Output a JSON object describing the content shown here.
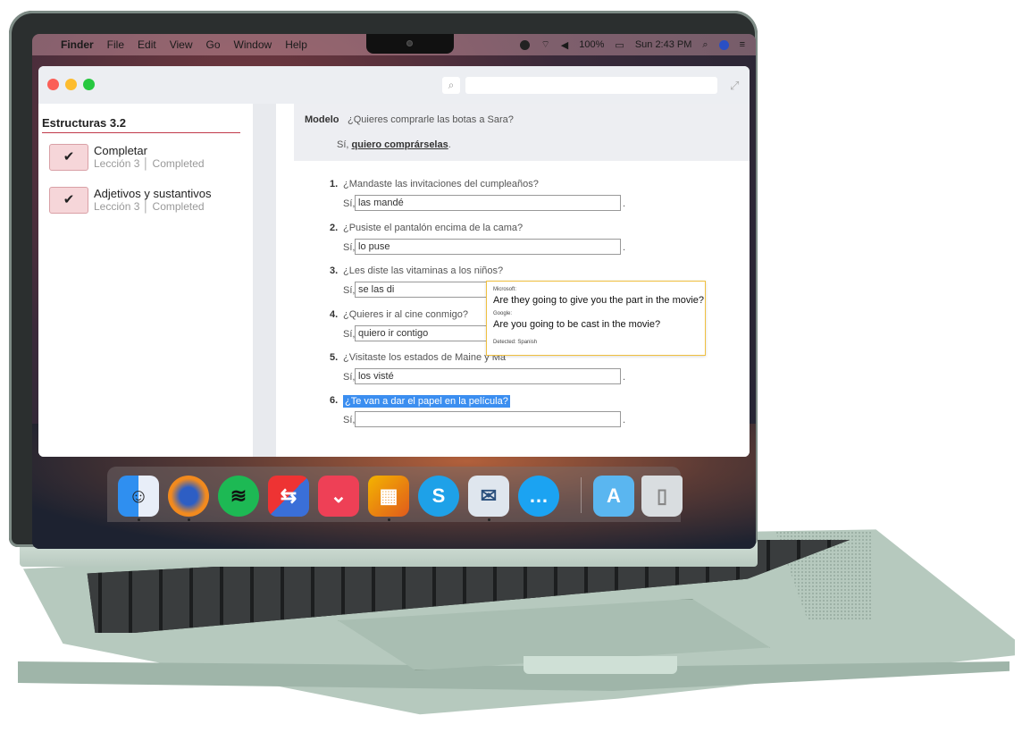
{
  "menubar": {
    "apple_icon": "apple-icon",
    "app_name": "Finder",
    "items": [
      "File",
      "Edit",
      "View",
      "Go",
      "Window",
      "Help"
    ],
    "battery": "100%",
    "clock": "Sun 2:43 PM"
  },
  "window": {
    "search_placeholder": ""
  },
  "sidebar": {
    "title": "Estructuras 3.2",
    "lessons": [
      {
        "name": "Completar",
        "lesson": "Lección 3",
        "status": "Completed"
      },
      {
        "name": "Adjetivos y sustantivos",
        "lesson": "Lección 3",
        "status": "Completed"
      }
    ]
  },
  "content": {
    "modelo_label": "Modelo",
    "modelo_question": "¿Quieres comprarle las botas a Sara?",
    "modelo_answer_prefix": "Sí,",
    "modelo_answer": "quiero comprárselas",
    "modelo_answer_suffix": ".",
    "questions": [
      {
        "num": "1.",
        "text": "¿Mandaste las invitaciones del cumpleaños?",
        "prefix": "Sí,",
        "answer": "las mandé"
      },
      {
        "num": "2.",
        "text": "¿Pusiste el pantalón encima de la cama?",
        "prefix": "Sí,",
        "answer": "lo puse"
      },
      {
        "num": "3.",
        "text": "¿Les diste las vitaminas a los niños?",
        "prefix": "Sí,",
        "answer": "se las di"
      },
      {
        "num": "4.",
        "text": "¿Quieres ir al cine conmigo?",
        "prefix": "Sí,",
        "answer": "quiero ir contigo"
      },
      {
        "num": "5.",
        "text": "¿Visitaste los estados de Maine y Ma",
        "prefix": "Sí,",
        "answer": "los visté"
      },
      {
        "num": "6.",
        "text": "¿Te van a dar el papel en la película?",
        "prefix": "Sí,",
        "answer": ""
      }
    ]
  },
  "tooltip": {
    "source1": "Microsoft:",
    "translation1": "Are they going to give you the part in the movie?",
    "source2": "Google:",
    "translation2": "Are you going to be cast in the movie?",
    "detected": "Detected: Spanish"
  },
  "dock": {
    "apps": [
      "finder-icon",
      "firefox-icon",
      "spotify-icon",
      "screen-sharing-icon",
      "pocket-icon",
      "preview-icon",
      "skype-icon",
      "mail-icon",
      "messages-icon",
      "applications-folder-icon",
      "trash-icon"
    ]
  },
  "colors": {
    "accent_red": "#c0394a",
    "check_bg": "#f6d6d9",
    "selection": "#3b8ef0",
    "tooltip_border": "#f0c040"
  }
}
